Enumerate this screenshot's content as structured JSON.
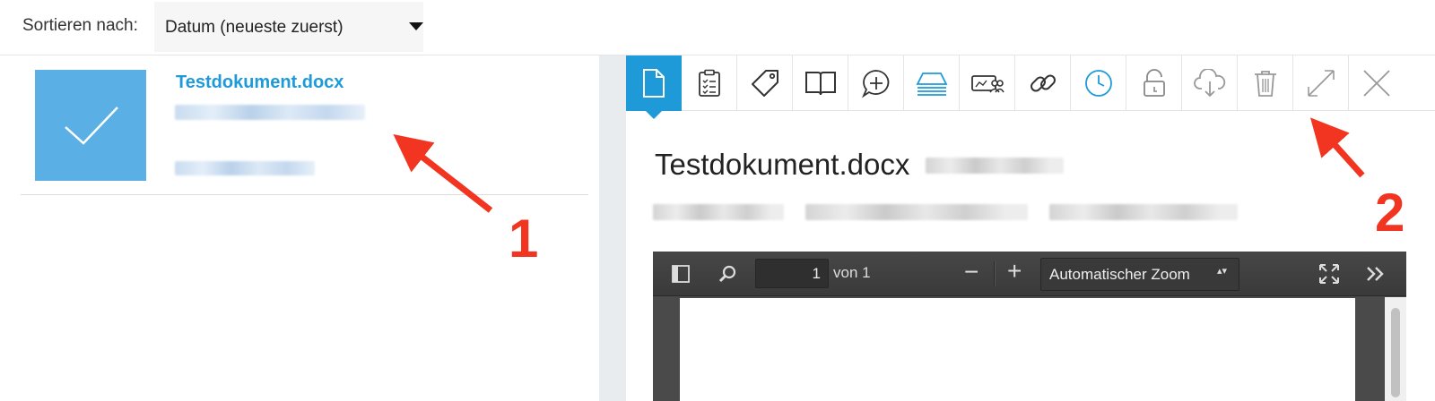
{
  "sort": {
    "label": "Sortieren nach:",
    "selected": "Datum (neueste zuerst)"
  },
  "list": {
    "items": [
      {
        "title": "Testdokument.docx",
        "selected": true,
        "thumb_icon": "check-icon"
      }
    ]
  },
  "toolbar": {
    "tools": [
      {
        "name": "document-icon",
        "active": true
      },
      {
        "name": "clipboard-checklist-icon"
      },
      {
        "name": "tag-icon"
      },
      {
        "name": "book-icon"
      },
      {
        "name": "comment-add-icon"
      },
      {
        "name": "layers-stack-icon"
      },
      {
        "name": "share-users-icon"
      },
      {
        "name": "link-icon"
      },
      {
        "name": "clock-icon"
      },
      {
        "name": "unlock-icon"
      },
      {
        "name": "cloud-download-icon"
      },
      {
        "name": "trash-icon"
      },
      {
        "name": "expand-icon"
      },
      {
        "name": "close-icon"
      }
    ]
  },
  "detail": {
    "title": "Testdokument.docx"
  },
  "viewer": {
    "page_number": "1",
    "page_of": "von 1",
    "zoom_minus": "−",
    "zoom_plus": "+",
    "zoom_label": "Automatischer Zoom",
    "zoom_arrows": "▴▾"
  },
  "annotations": {
    "one": "1",
    "two": "2",
    "color": "#f23520"
  },
  "colors": {
    "accent": "#1e9ad9",
    "thumb": "#5aafe4"
  }
}
